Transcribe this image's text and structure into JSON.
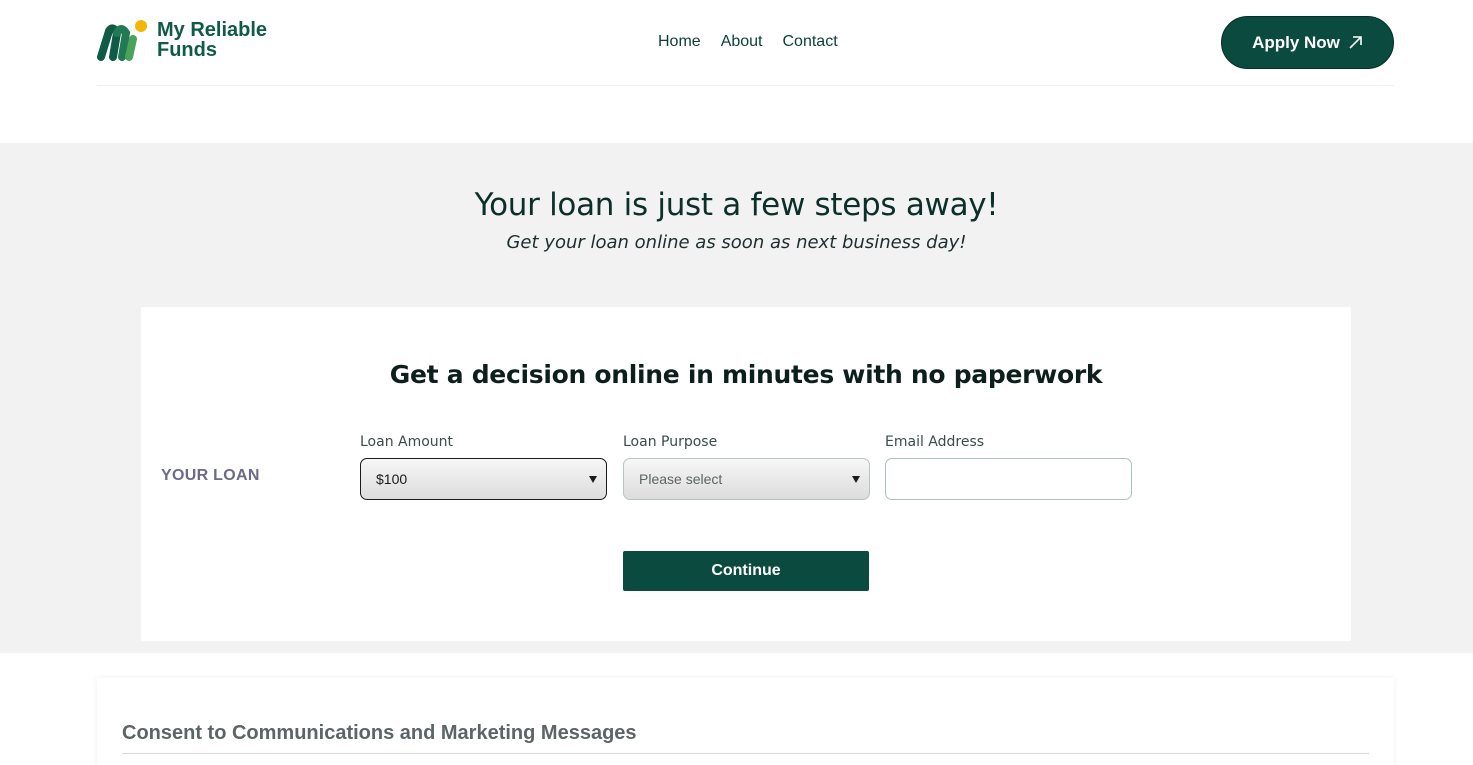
{
  "header": {
    "logo_line1": "My Reliable",
    "logo_line2": "Funds",
    "nav": [
      {
        "label": "Home"
      },
      {
        "label": "About"
      },
      {
        "label": "Contact"
      }
    ],
    "apply_label": "Apply Now"
  },
  "hero": {
    "title": "Your loan is just a few steps away!",
    "subtitle": "Get your loan online as soon as next business day!"
  },
  "form": {
    "title": "Get a decision online in minutes with no paperwork",
    "section_label": "YOUR LOAN",
    "loan_amount": {
      "label": "Loan Amount",
      "value": "$100"
    },
    "loan_purpose": {
      "label": "Loan Purpose",
      "value": "Please select"
    },
    "email": {
      "label": "Email Address",
      "value": ""
    },
    "continue_label": "Continue"
  },
  "consent": {
    "title": "Consent to Communications and Marketing Messages"
  },
  "colors": {
    "brand_dark": "#0b4a3f",
    "brand_green": "#0f5b45",
    "accent_gold": "#f2b705",
    "band_bg": "#f2f2f2"
  }
}
